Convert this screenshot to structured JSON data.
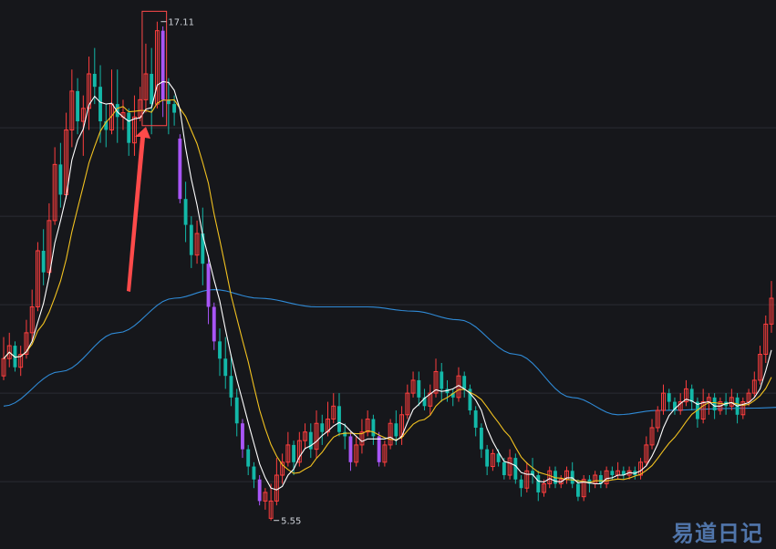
{
  "chart_data": {
    "type": "candlestick",
    "ylim": [
      5.1,
      17.4
    ],
    "gridlines": [
      14.65,
      12.6,
      10.55,
      8.5,
      6.45,
      4.4
    ],
    "grid": true,
    "colors": {
      "background": "#16171b",
      "up": "#ff3e3e",
      "down": "#13b8a8",
      "limit": "#a855f7",
      "ma5": "#ffffff",
      "ma10": "#f2c220",
      "ma60": "#2f8ad6",
      "marker": "#ff4a4a",
      "grid": "#2b2d33"
    },
    "annotations": {
      "high_label": "17.11",
      "low_label": "5.55",
      "high_value": 17.11,
      "low_value": 5.55
    },
    "candles": [
      [
        8.9,
        9.3,
        9.8,
        8.8
      ],
      [
        9.3,
        9.6,
        9.9,
        9.1
      ],
      [
        9.6,
        9.1,
        9.7,
        9.0
      ],
      [
        9.1,
        9.4,
        9.6,
        8.9
      ],
      [
        9.4,
        9.9,
        10.2,
        9.3
      ],
      [
        9.9,
        10.5,
        10.9,
        9.7
      ],
      [
        10.5,
        11.8,
        12.0,
        10.4
      ],
      [
        11.8,
        11.3,
        12.3,
        11.0
      ],
      [
        11.3,
        12.5,
        12.9,
        11.2
      ],
      [
        12.5,
        13.8,
        14.2,
        12.4
      ],
      [
        13.8,
        13.1,
        14.3,
        12.8
      ],
      [
        13.1,
        14.6,
        15.0,
        13.0
      ],
      [
        14.6,
        15.5,
        16.0,
        14.2
      ],
      [
        15.5,
        14.8,
        15.8,
        14.5
      ],
      [
        14.8,
        15.1,
        15.4,
        14.0
      ],
      [
        15.1,
        15.9,
        16.3,
        14.6
      ],
      [
        15.9,
        15.6,
        16.5,
        15.2
      ],
      [
        15.6,
        14.8,
        16.1,
        14.3
      ],
      [
        14.8,
        14.6,
        15.2,
        14.2
      ],
      [
        14.6,
        15.2,
        16.0,
        14.5
      ],
      [
        15.2,
        14.9,
        16.0,
        14.3
      ],
      [
        14.9,
        15.0,
        15.3,
        14.6
      ],
      [
        15.0,
        14.3,
        15.1,
        14.0
      ],
      [
        14.3,
        14.9,
        15.4,
        14.0
      ],
      [
        14.9,
        15.3,
        15.6,
        14.8
      ],
      [
        15.3,
        15.9,
        16.6,
        15.0
      ],
      [
        15.9,
        15.2,
        16.5,
        14.5
      ],
      [
        15.2,
        16.9,
        17.11,
        15.1
      ],
      [
        16.9,
        15.3,
        17.0,
        14.9
      ],
      [
        15.3,
        15.2,
        15.8,
        14.5
      ],
      [
        15.2,
        15.0,
        15.4,
        14.7
      ],
      [
        14.4,
        13.0,
        14.5,
        12.9
      ],
      [
        13.0,
        12.4,
        13.4,
        12.0
      ],
      [
        12.4,
        11.7,
        12.6,
        11.4
      ],
      [
        11.7,
        12.2,
        12.5,
        11.5
      ],
      [
        12.2,
        11.5,
        12.8,
        11.0
      ],
      [
        11.5,
        10.5,
        11.7,
        10.1
      ],
      [
        10.5,
        9.7,
        10.6,
        9.5
      ],
      [
        9.7,
        9.3,
        10.0,
        8.9
      ],
      [
        9.3,
        8.9,
        9.8,
        8.6
      ],
      [
        8.9,
        8.4,
        9.4,
        8.2
      ],
      [
        8.4,
        7.8,
        8.6,
        7.5
      ],
      [
        7.8,
        7.2,
        7.9,
        7.0
      ],
      [
        7.2,
        6.8,
        7.3,
        6.6
      ],
      [
        6.8,
        6.5,
        6.9,
        6.3
      ],
      [
        6.5,
        6.0,
        6.6,
        5.9
      ],
      [
        6.0,
        6.2,
        6.3,
        5.8
      ],
      [
        5.6,
        6.0,
        6.4,
        5.55
      ],
      [
        6.0,
        6.6,
        7.0,
        5.9
      ],
      [
        6.6,
        6.9,
        7.1,
        6.4
      ],
      [
        6.9,
        7.3,
        7.6,
        6.8
      ],
      [
        7.3,
        6.9,
        7.4,
        6.6
      ],
      [
        6.9,
        7.4,
        7.6,
        6.8
      ],
      [
        7.4,
        7.6,
        7.8,
        7.2
      ],
      [
        7.6,
        7.2,
        7.8,
        7.0
      ],
      [
        7.2,
        7.8,
        8.1,
        7.0
      ],
      [
        7.8,
        7.6,
        8.0,
        7.3
      ],
      [
        7.6,
        7.9,
        8.3,
        7.5
      ],
      [
        7.9,
        8.2,
        8.5,
        7.8
      ],
      [
        8.2,
        7.6,
        8.5,
        7.5
      ],
      [
        7.6,
        7.5,
        7.8,
        7.2
      ],
      [
        7.5,
        6.9,
        7.6,
        6.7
      ],
      [
        6.9,
        7.3,
        7.5,
        6.8
      ],
      [
        7.3,
        7.6,
        7.9,
        7.1
      ],
      [
        7.6,
        7.9,
        8.1,
        7.5
      ],
      [
        7.9,
        7.5,
        8.0,
        7.3
      ],
      [
        7.5,
        6.9,
        7.6,
        6.8
      ],
      [
        6.9,
        7.3,
        7.4,
        6.8
      ],
      [
        7.3,
        7.8,
        7.9,
        7.2
      ],
      [
        7.8,
        7.5,
        8.1,
        7.3
      ],
      [
        7.5,
        8.0,
        8.2,
        7.3
      ],
      [
        8.0,
        8.5,
        8.7,
        7.9
      ],
      [
        8.5,
        8.8,
        9.0,
        8.4
      ],
      [
        8.8,
        8.4,
        9.0,
        8.2
      ],
      [
        8.4,
        8.2,
        8.6,
        8.1
      ],
      [
        8.2,
        8.5,
        8.7,
        8.0
      ],
      [
        8.5,
        9.0,
        9.3,
        8.4
      ],
      [
        9.0,
        8.6,
        9.2,
        8.3
      ],
      [
        8.6,
        8.5,
        8.8,
        8.3
      ],
      [
        8.5,
        8.4,
        8.6,
        8.2
      ],
      [
        8.4,
        8.9,
        9.1,
        8.3
      ],
      [
        8.9,
        8.6,
        9.0,
        8.4
      ],
      [
        8.6,
        8.1,
        8.7,
        8.0
      ],
      [
        8.1,
        7.7,
        8.2,
        7.5
      ],
      [
        7.7,
        7.2,
        7.8,
        7.0
      ],
      [
        7.2,
        6.8,
        7.3,
        6.6
      ],
      [
        6.8,
        7.1,
        7.2,
        6.7
      ],
      [
        7.1,
        6.9,
        7.2,
        6.8
      ],
      [
        6.9,
        6.6,
        7.0,
        6.5
      ],
      [
        6.6,
        7.0,
        7.2,
        6.5
      ],
      [
        7.0,
        6.5,
        7.1,
        6.4
      ],
      [
        6.5,
        6.3,
        6.6,
        6.1
      ],
      [
        6.3,
        6.7,
        6.9,
        6.2
      ],
      [
        6.7,
        6.6,
        7.0,
        6.4
      ],
      [
        6.6,
        6.2,
        6.7,
        6.0
      ],
      [
        6.2,
        6.4,
        6.5,
        6.1
      ],
      [
        6.4,
        6.7,
        6.8,
        6.3
      ],
      [
        6.7,
        6.4,
        6.8,
        6.3
      ],
      [
        6.4,
        6.5,
        6.6,
        6.3
      ],
      [
        6.5,
        6.7,
        6.8,
        6.4
      ],
      [
        6.7,
        6.4,
        6.9,
        6.3
      ],
      [
        6.4,
        6.1,
        6.5,
        6.0
      ],
      [
        6.1,
        6.5,
        6.6,
        6.0
      ],
      [
        6.5,
        6.4,
        6.6,
        6.2
      ],
      [
        6.4,
        6.6,
        6.7,
        6.3
      ],
      [
        6.6,
        6.4,
        6.7,
        6.3
      ],
      [
        6.4,
        6.7,
        6.8,
        6.3
      ],
      [
        6.7,
        6.6,
        6.8,
        6.5
      ],
      [
        6.6,
        6.7,
        6.9,
        6.5
      ],
      [
        6.7,
        6.6,
        6.8,
        6.5
      ],
      [
        6.6,
        6.7,
        6.8,
        6.5
      ],
      [
        6.7,
        6.6,
        6.8,
        6.5
      ],
      [
        6.6,
        6.9,
        7.0,
        6.5
      ],
      [
        6.9,
        7.3,
        7.5,
        6.8
      ],
      [
        7.3,
        7.7,
        7.9,
        7.2
      ],
      [
        7.7,
        8.1,
        8.2,
        7.6
      ],
      [
        8.1,
        8.5,
        8.7,
        8.0
      ],
      [
        8.5,
        8.3,
        8.6,
        8.1
      ],
      [
        8.3,
        8.1,
        8.4,
        8.0
      ],
      [
        8.1,
        8.3,
        8.5,
        8.0
      ],
      [
        8.3,
        8.6,
        8.8,
        8.2
      ],
      [
        8.6,
        8.3,
        8.7,
        8.1
      ],
      [
        8.3,
        7.9,
        8.4,
        7.7
      ],
      [
        7.9,
        8.3,
        8.6,
        7.8
      ],
      [
        8.3,
        8.4,
        8.5,
        8.0
      ],
      [
        8.4,
        8.1,
        8.5,
        7.9
      ],
      [
        8.1,
        8.3,
        8.4,
        8.0
      ],
      [
        8.3,
        8.2,
        8.5,
        8.0
      ],
      [
        8.2,
        8.4,
        8.6,
        8.1
      ],
      [
        8.4,
        8.0,
        8.5,
        7.8
      ],
      [
        8.0,
        8.3,
        8.4,
        7.9
      ],
      [
        8.3,
        8.5,
        8.6,
        8.2
      ],
      [
        8.5,
        8.8,
        9.0,
        8.4
      ],
      [
        8.8,
        9.4,
        9.6,
        8.7
      ],
      [
        9.4,
        10.1,
        10.3,
        9.2
      ],
      [
        10.1,
        10.7,
        11.1,
        9.9
      ]
    ],
    "ma60": [
      [
        0,
        8.2
      ],
      [
        10,
        9.0
      ],
      [
        20,
        9.9
      ],
      [
        30,
        10.7
      ],
      [
        37,
        10.9
      ],
      [
        45,
        10.7
      ],
      [
        55,
        10.5
      ],
      [
        64,
        10.5
      ],
      [
        72,
        10.4
      ],
      [
        80,
        10.2
      ],
      [
        90,
        9.4
      ],
      [
        100,
        8.4
      ],
      [
        108,
        8.0
      ],
      [
        115,
        8.1
      ],
      [
        130,
        8.15
      ],
      [
        143,
        8.2
      ]
    ]
  }
}
